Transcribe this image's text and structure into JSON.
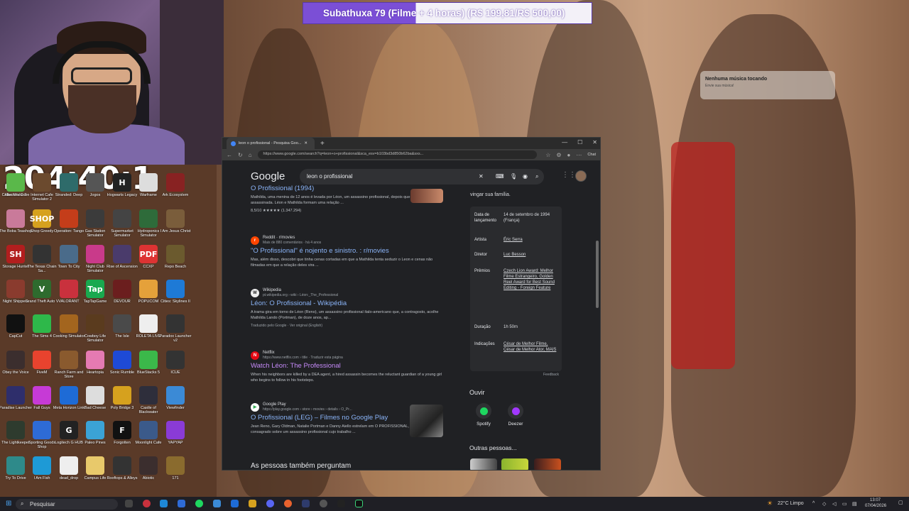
{
  "overlay": {
    "banner": "Subathuxa 79 (Filme + 4 horas) (R$ 199,81/R$ 500,00)",
    "timer": "204:40:1",
    "toast_title": "Nenhuma música tocando",
    "toast_sub": "Envie sua música!"
  },
  "desktop_icons": [
    {
      "label": "Alan Wake 2",
      "color": "#3b4a6b",
      "glyph": ""
    },
    {
      "label": "Internet Cafe Simulator 2",
      "color": "#6b4a2e",
      "glyph": ""
    },
    {
      "label": "Stranded: Deep",
      "color": "#2e6b6a",
      "glyph": ""
    },
    {
      "label": "Jogos",
      "color": "#555",
      "glyph": ""
    },
    {
      "label": "Hogwarts Legacy",
      "color": "#222",
      "glyph": "H"
    },
    {
      "label": "Warframe",
      "color": "#ddd",
      "glyph": ""
    },
    {
      "label": "Ark Ecosystem",
      "color": "#882222",
      "glyph": ""
    },
    {
      "label": "The Boba Teashop",
      "color": "#c97a9a",
      "glyph": ""
    },
    {
      "label": "Shop Greedy",
      "color": "#d6a11e",
      "glyph": "SHOP"
    },
    {
      "label": "Operation: Tango",
      "color": "#c43d1a",
      "glyph": ""
    },
    {
      "label": "Gas Station Simulator",
      "color": "#3b3b3b",
      "glyph": ""
    },
    {
      "label": "Supermarket Simulator",
      "color": "#444",
      "glyph": ""
    },
    {
      "label": "Hydroponics Simulator",
      "color": "#2e6b3a",
      "glyph": ""
    },
    {
      "label": "I Am Jesus Christ",
      "color": "#7a5d3b",
      "glyph": ""
    },
    {
      "label": "Storage Hunter",
      "color": "#b21e1e",
      "glyph": "SH"
    },
    {
      "label": "The Texas Chain Sa...",
      "color": "#333",
      "glyph": ""
    },
    {
      "label": "Town To City",
      "color": "#4a6b8a",
      "glyph": ""
    },
    {
      "label": "Night Club Simulator",
      "color": "#c93a8a",
      "glyph": ""
    },
    {
      "label": "Rise of Ascension",
      "color": "#4a3b6b",
      "glyph": ""
    },
    {
      "label": "CCXP",
      "color": "#d33",
      "glyph": "PDF"
    },
    {
      "label": "Repo Beach",
      "color": "#6b5a2e",
      "glyph": ""
    },
    {
      "label": "Night Shippers",
      "color": "#8a3b2e",
      "glyph": ""
    },
    {
      "label": "Grand Theft Auto V",
      "color": "#2e6b2e",
      "glyph": "V"
    },
    {
      "label": "VALORANT",
      "color": "#c9313d",
      "glyph": ""
    },
    {
      "label": "TapTapGame",
      "color": "#19a94f",
      "glyph": "Tap"
    },
    {
      "label": "DEVOUR",
      "color": "#6b1e1e",
      "glyph": ""
    },
    {
      "label": "POPUCOM",
      "color": "#e5a13a",
      "glyph": ""
    },
    {
      "label": "Cities: Skylines II",
      "color": "#1e7ad6",
      "glyph": ""
    },
    {
      "label": "CapCut",
      "color": "#111",
      "glyph": ""
    },
    {
      "label": "The Sims 4",
      "color": "#2eb84a",
      "glyph": ""
    },
    {
      "label": "Cooking Simulator",
      "color": "#a3651e",
      "glyph": ""
    },
    {
      "label": "Cowboy Life Simulator",
      "color": "#5a3b1e",
      "glyph": ""
    },
    {
      "label": "The Isle",
      "color": "#4a4a4a",
      "glyph": ""
    },
    {
      "label": "ROLETA LIVE",
      "color": "#eee",
      "glyph": ""
    },
    {
      "label": "Paradox Launcher v2",
      "color": "#333",
      "glyph": ""
    },
    {
      "label": "Obey the Voice",
      "color": "#3b2e2e",
      "glyph": ""
    },
    {
      "label": "FiveM",
      "color": "#e8432e",
      "glyph": ""
    },
    {
      "label": "Ranch Farm and Store",
      "color": "#8a5a2e",
      "glyph": ""
    },
    {
      "label": "Heartopia",
      "color": "#e57ab2",
      "glyph": ""
    },
    {
      "label": "Sonic Rumble",
      "color": "#1e4ad6",
      "glyph": ""
    },
    {
      "label": "BlueStacks 5",
      "color": "#3bb84a",
      "glyph": ""
    },
    {
      "label": "ICUE",
      "color": "#333",
      "glyph": ""
    },
    {
      "label": "Paradise Launcher",
      "color": "#2e2e6b",
      "glyph": ""
    },
    {
      "label": "Fall Guys",
      "color": "#c63ad6",
      "glyph": ""
    },
    {
      "label": "Meta Horizon Link",
      "color": "#1e6bd6",
      "glyph": ""
    },
    {
      "label": "Bad Cheese",
      "color": "#ddd",
      "glyph": ""
    },
    {
      "label": "Poly Bridge 3",
      "color": "#d6a11e",
      "glyph": ""
    },
    {
      "label": "Castle of Blackwater",
      "color": "#2e2e3b",
      "glyph": ""
    },
    {
      "label": "Viewfinder",
      "color": "#3b8ad6",
      "glyph": ""
    },
    {
      "label": "The Lightkeeper",
      "color": "#2e3b2e",
      "glyph": ""
    },
    {
      "label": "Sporting Goods Shop",
      "color": "#2e6bd6",
      "glyph": ""
    },
    {
      "label": "Logitech G HUB",
      "color": "#222",
      "glyph": "G"
    },
    {
      "label": "Paleo Pines",
      "color": "#3ba3d6",
      "glyph": ""
    },
    {
      "label": "Forgotten",
      "color": "#111",
      "glyph": "F"
    },
    {
      "label": "Moonlight Cafe",
      "color": "#3b5a8a",
      "glyph": ""
    },
    {
      "label": "YAPYAP",
      "color": "#8a3bd6",
      "glyph": ""
    },
    {
      "label": "Try To Drive",
      "color": "#2e8a8a",
      "glyph": ""
    },
    {
      "label": "I Am Fish",
      "color": "#1e9ad6",
      "glyph": ""
    },
    {
      "label": "dead_drop",
      "color": "#eee",
      "glyph": ""
    },
    {
      "label": "Campus Life",
      "color": "#e8c96b",
      "glyph": ""
    },
    {
      "label": "Rooftops & Alleys",
      "color": "#333",
      "glyph": ""
    },
    {
      "label": "Abiotic",
      "color": "#3b2e2e",
      "glyph": ""
    },
    {
      "label": "171",
      "color": "#8a6b2e",
      "glyph": ""
    },
    {
      "label": "Collectors Cove",
      "color": "#5ab84a",
      "glyph": ""
    }
  ],
  "browser": {
    "tab_title": "leon o profissional - Pesquisa Goo...",
    "url": "https://www.google.com/search?q=leon+o+profissional&sca_esv=b103bd3d850b62ba&sxs...",
    "chat_label": "Chat",
    "logo": "Google",
    "query": "leon o profissional"
  },
  "results": [
    {
      "site": "",
      "url": "",
      "title": "O Profissional (1994)",
      "visited": false,
      "snippet": "Mathilda, uma menina de 12 anos é levada por Léon, um assassino profissional, depois que sua família é assassinada. Léon e Mathilda formam uma relação ...",
      "rating": "8,5/10 ★★★★★ (1.347.294)"
    },
    {
      "site": "Reddit · r/movies",
      "url": "Mais de 880 comentários · há 4 anos",
      "title": "\"O Profissional\" é nojento e sinistro. : r/movies",
      "visited": false,
      "snippet": "Mas, além disso, descobri que tinha cenas cortadas em que a Mathilda tenta seduzir o Leon e cenas não filmadas em que a relação deles vira ..."
    },
    {
      "site": "Wikipedia",
      "url": "pt.wikipedia.org › wiki › Léon:_The_Professional",
      "title": "Léon: O Profissional - Wikipédia",
      "visited": false,
      "snippet": "A trama gira em torno de Léon (Reno), um assassino profissional ítalo-americano que, a contragosto, acolhe Mathilda Lando (Portman), de doze anos, ap...",
      "translated": "Traduzido pelo Google · Ver original (English)"
    },
    {
      "site": "Netflix",
      "url": "https://www.netflix.com › title · Traduzir esta página",
      "title": "Watch Léon: The Professional",
      "visited": true,
      "snippet": "When his neighbors are killed by a DEA agent, a hired assassin becomes the reluctant guardian of a young girl who begins to follow in his footsteps."
    },
    {
      "site": "Google Play",
      "url": "https://play.google.com › store › movies › details › O_Pr...",
      "title": "O Profissional (LEG) – Filmes no Google Play",
      "visited": false,
      "snippet": "Jean Reno, Gary Oldman, Natalie Portman e Danny Aiello estrelam em O PROFISSIONAL, um filme de ação consagrado sobre um assassino profissional cujo trabalho ..."
    }
  ],
  "people_also_ask": "As pessoas também perguntam",
  "kp": {
    "lead": "vingar sua família.",
    "rows": [
      {
        "k": "Data de lançamento",
        "v": "14 de setembro de 1994 (França)"
      },
      {
        "k": "Artista",
        "v": "Éric Serra"
      },
      {
        "k": "Diretor",
        "v": "Luc Besson"
      },
      {
        "k": "Prêmios",
        "v": "Czech Lion Award: Melhor Filme Estrangeiro, Golden Reel Award for Best Sound Editing - Foreign Feature"
      },
      {
        "k": "Duração",
        "v": "1h 50m"
      },
      {
        "k": "Indicações",
        "v": "César de Melhor Filme, César de Melhor Ator, MAIS"
      }
    ],
    "feedback": "Feedback",
    "ouvir": "Ouvir",
    "services": [
      {
        "name": "Spotify",
        "color": "#1ed760"
      },
      {
        "name": "Deezer",
        "color": "#a238ff"
      }
    ],
    "outras": "Outras pessoas..."
  },
  "taskbar": {
    "search": "Pesquisar",
    "weather": "22°C  Limpo",
    "time": "13:07",
    "date": "07/04/2026"
  }
}
